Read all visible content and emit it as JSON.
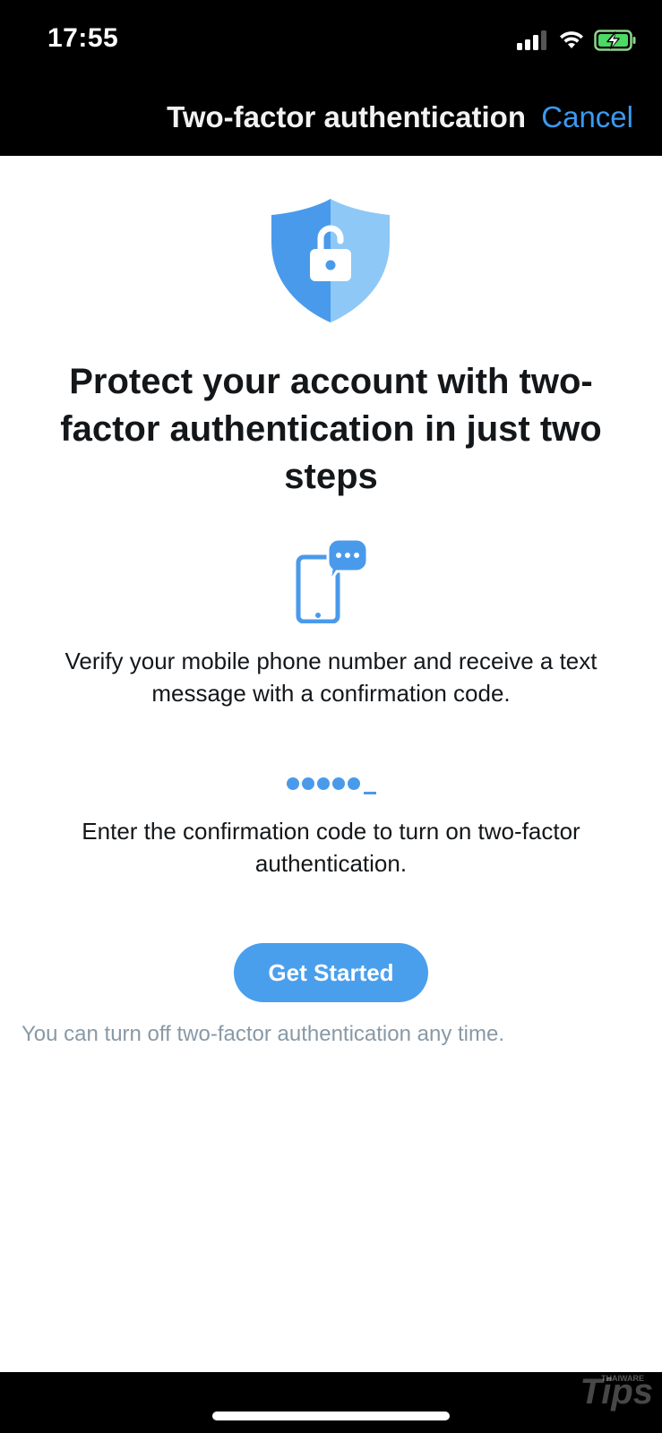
{
  "status_bar": {
    "time": "17:55",
    "icons": [
      "cellular-signal-icon",
      "wifi-icon",
      "battery-charging-icon"
    ]
  },
  "nav": {
    "title": "Two-factor authentication",
    "cancel_label": "Cancel"
  },
  "main": {
    "headline": "Protect your account with two-factor authentication in just two steps",
    "step1_text": "Verify your mobile phone number and receive a text message with a confirmation code.",
    "step2_text": "Enter the confirmation code to turn on two-factor authentication.",
    "get_started_label": "Get Started",
    "footnote": "You can turn off two-factor authentication any time."
  },
  "watermark": {
    "text": "Tips",
    "brand": "THAIWARE"
  },
  "colors": {
    "accent": "#4a9fed",
    "link": "#3b9af0",
    "shield_dark": "#4a9aeb",
    "shield_light": "#8dc8f7",
    "muted_text": "#8899a6"
  }
}
